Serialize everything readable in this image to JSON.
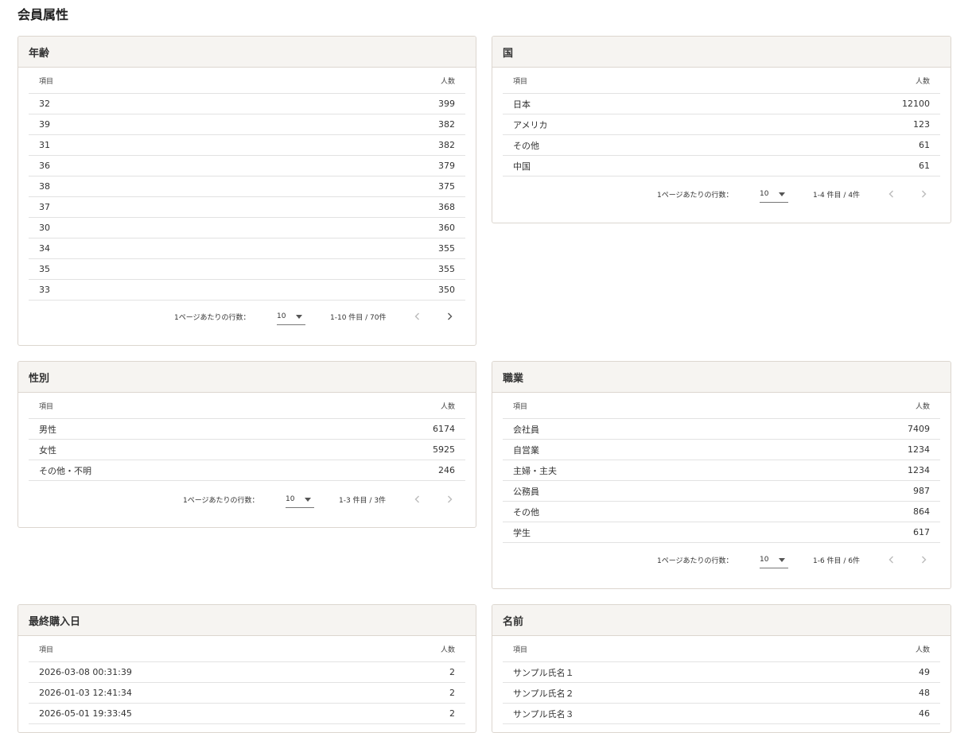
{
  "page": {
    "title": "会員属性"
  },
  "colors": {
    "header_bg": "#f6f4f1",
    "border": "#dcd6cf"
  },
  "common": {
    "col_item": "項目",
    "col_count": "人数",
    "rows_per_page_label": "1ページあたりの行数：",
    "rows_per_page": "10"
  },
  "cards": {
    "age": {
      "title": "年齢",
      "range": "1-10 件目 / 70件",
      "rows": [
        {
          "label": "32",
          "count": "399"
        },
        {
          "label": "39",
          "count": "382"
        },
        {
          "label": "31",
          "count": "382"
        },
        {
          "label": "36",
          "count": "379"
        },
        {
          "label": "38",
          "count": "375"
        },
        {
          "label": "37",
          "count": "368"
        },
        {
          "label": "30",
          "count": "360"
        },
        {
          "label": "34",
          "count": "355"
        },
        {
          "label": "35",
          "count": "355"
        },
        {
          "label": "33",
          "count": "350"
        }
      ]
    },
    "country": {
      "title": "国",
      "range": "1-4 件目 / 4件",
      "rows": [
        {
          "label": "日本",
          "count": "12100"
        },
        {
          "label": "アメリカ",
          "count": "123"
        },
        {
          "label": "その他",
          "count": "61"
        },
        {
          "label": "中国",
          "count": "61"
        }
      ]
    },
    "gender": {
      "title": "性別",
      "range": "1-3 件目 / 3件",
      "rows": [
        {
          "label": "男性",
          "count": "6174"
        },
        {
          "label": "女性",
          "count": "5925"
        },
        {
          "label": "その他・不明",
          "count": "246"
        }
      ]
    },
    "job": {
      "title": "職業",
      "range": "1-6 件目 / 6件",
      "rows": [
        {
          "label": "会社員",
          "count": "7409"
        },
        {
          "label": "自営業",
          "count": "1234"
        },
        {
          "label": "主婦・主夫",
          "count": "1234"
        },
        {
          "label": "公務員",
          "count": "987"
        },
        {
          "label": "その他",
          "count": "864"
        },
        {
          "label": "学生",
          "count": "617"
        }
      ]
    },
    "last_purchase": {
      "title": "最終購入日",
      "rows": [
        {
          "label": "2026-03-08 00:31:39",
          "count": "2"
        },
        {
          "label": "2026-01-03 12:41:34",
          "count": "2"
        },
        {
          "label": "2026-05-01 19:33:45",
          "count": "2"
        }
      ]
    },
    "name": {
      "title": "名前",
      "rows": [
        {
          "label": "サンプル氏名１",
          "count": "49"
        },
        {
          "label": "サンプル氏名２",
          "count": "48"
        },
        {
          "label": "サンプル氏名３",
          "count": "46"
        }
      ]
    }
  }
}
